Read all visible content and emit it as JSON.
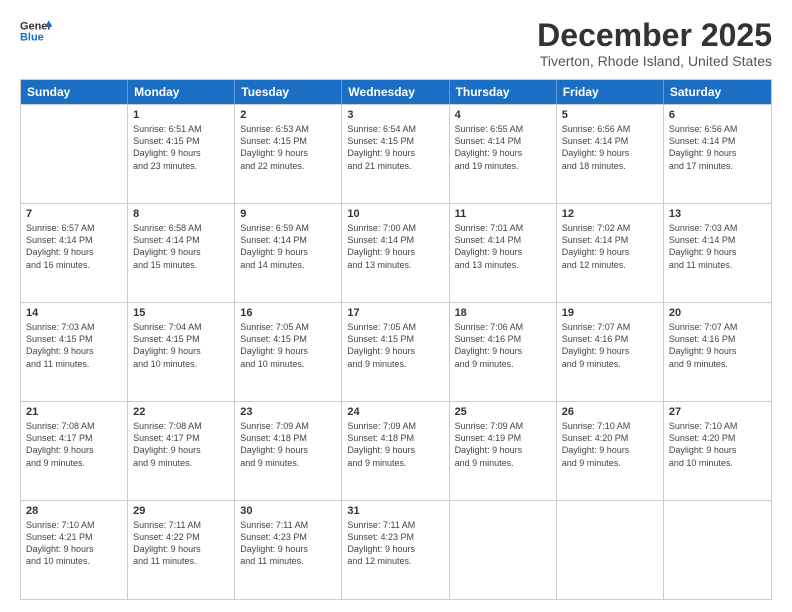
{
  "header": {
    "logo_line1": "General",
    "logo_line2": "Blue",
    "month": "December 2025",
    "location": "Tiverton, Rhode Island, United States"
  },
  "days_of_week": [
    "Sunday",
    "Monday",
    "Tuesday",
    "Wednesday",
    "Thursday",
    "Friday",
    "Saturday"
  ],
  "weeks": [
    [
      {
        "day": "",
        "info": ""
      },
      {
        "day": "1",
        "info": "Sunrise: 6:51 AM\nSunset: 4:15 PM\nDaylight: 9 hours\nand 23 minutes."
      },
      {
        "day": "2",
        "info": "Sunrise: 6:53 AM\nSunset: 4:15 PM\nDaylight: 9 hours\nand 22 minutes."
      },
      {
        "day": "3",
        "info": "Sunrise: 6:54 AM\nSunset: 4:15 PM\nDaylight: 9 hours\nand 21 minutes."
      },
      {
        "day": "4",
        "info": "Sunrise: 6:55 AM\nSunset: 4:14 PM\nDaylight: 9 hours\nand 19 minutes."
      },
      {
        "day": "5",
        "info": "Sunrise: 6:56 AM\nSunset: 4:14 PM\nDaylight: 9 hours\nand 18 minutes."
      },
      {
        "day": "6",
        "info": "Sunrise: 6:56 AM\nSunset: 4:14 PM\nDaylight: 9 hours\nand 17 minutes."
      }
    ],
    [
      {
        "day": "7",
        "info": "Sunrise: 6:57 AM\nSunset: 4:14 PM\nDaylight: 9 hours\nand 16 minutes."
      },
      {
        "day": "8",
        "info": "Sunrise: 6:58 AM\nSunset: 4:14 PM\nDaylight: 9 hours\nand 15 minutes."
      },
      {
        "day": "9",
        "info": "Sunrise: 6:59 AM\nSunset: 4:14 PM\nDaylight: 9 hours\nand 14 minutes."
      },
      {
        "day": "10",
        "info": "Sunrise: 7:00 AM\nSunset: 4:14 PM\nDaylight: 9 hours\nand 13 minutes."
      },
      {
        "day": "11",
        "info": "Sunrise: 7:01 AM\nSunset: 4:14 PM\nDaylight: 9 hours\nand 13 minutes."
      },
      {
        "day": "12",
        "info": "Sunrise: 7:02 AM\nSunset: 4:14 PM\nDaylight: 9 hours\nand 12 minutes."
      },
      {
        "day": "13",
        "info": "Sunrise: 7:03 AM\nSunset: 4:14 PM\nDaylight: 9 hours\nand 11 minutes."
      }
    ],
    [
      {
        "day": "14",
        "info": "Sunrise: 7:03 AM\nSunset: 4:15 PM\nDaylight: 9 hours\nand 11 minutes."
      },
      {
        "day": "15",
        "info": "Sunrise: 7:04 AM\nSunset: 4:15 PM\nDaylight: 9 hours\nand 10 minutes."
      },
      {
        "day": "16",
        "info": "Sunrise: 7:05 AM\nSunset: 4:15 PM\nDaylight: 9 hours\nand 10 minutes."
      },
      {
        "day": "17",
        "info": "Sunrise: 7:05 AM\nSunset: 4:15 PM\nDaylight: 9 hours\nand 9 minutes."
      },
      {
        "day": "18",
        "info": "Sunrise: 7:06 AM\nSunset: 4:16 PM\nDaylight: 9 hours\nand 9 minutes."
      },
      {
        "day": "19",
        "info": "Sunrise: 7:07 AM\nSunset: 4:16 PM\nDaylight: 9 hours\nand 9 minutes."
      },
      {
        "day": "20",
        "info": "Sunrise: 7:07 AM\nSunset: 4:16 PM\nDaylight: 9 hours\nand 9 minutes."
      }
    ],
    [
      {
        "day": "21",
        "info": "Sunrise: 7:08 AM\nSunset: 4:17 PM\nDaylight: 9 hours\nand 9 minutes."
      },
      {
        "day": "22",
        "info": "Sunrise: 7:08 AM\nSunset: 4:17 PM\nDaylight: 9 hours\nand 9 minutes."
      },
      {
        "day": "23",
        "info": "Sunrise: 7:09 AM\nSunset: 4:18 PM\nDaylight: 9 hours\nand 9 minutes."
      },
      {
        "day": "24",
        "info": "Sunrise: 7:09 AM\nSunset: 4:18 PM\nDaylight: 9 hours\nand 9 minutes."
      },
      {
        "day": "25",
        "info": "Sunrise: 7:09 AM\nSunset: 4:19 PM\nDaylight: 9 hours\nand 9 minutes."
      },
      {
        "day": "26",
        "info": "Sunrise: 7:10 AM\nSunset: 4:20 PM\nDaylight: 9 hours\nand 9 minutes."
      },
      {
        "day": "27",
        "info": "Sunrise: 7:10 AM\nSunset: 4:20 PM\nDaylight: 9 hours\nand 10 minutes."
      }
    ],
    [
      {
        "day": "28",
        "info": "Sunrise: 7:10 AM\nSunset: 4:21 PM\nDaylight: 9 hours\nand 10 minutes."
      },
      {
        "day": "29",
        "info": "Sunrise: 7:11 AM\nSunset: 4:22 PM\nDaylight: 9 hours\nand 11 minutes."
      },
      {
        "day": "30",
        "info": "Sunrise: 7:11 AM\nSunset: 4:23 PM\nDaylight: 9 hours\nand 11 minutes."
      },
      {
        "day": "31",
        "info": "Sunrise: 7:11 AM\nSunset: 4:23 PM\nDaylight: 9 hours\nand 12 minutes."
      },
      {
        "day": "",
        "info": ""
      },
      {
        "day": "",
        "info": ""
      },
      {
        "day": "",
        "info": ""
      }
    ]
  ]
}
